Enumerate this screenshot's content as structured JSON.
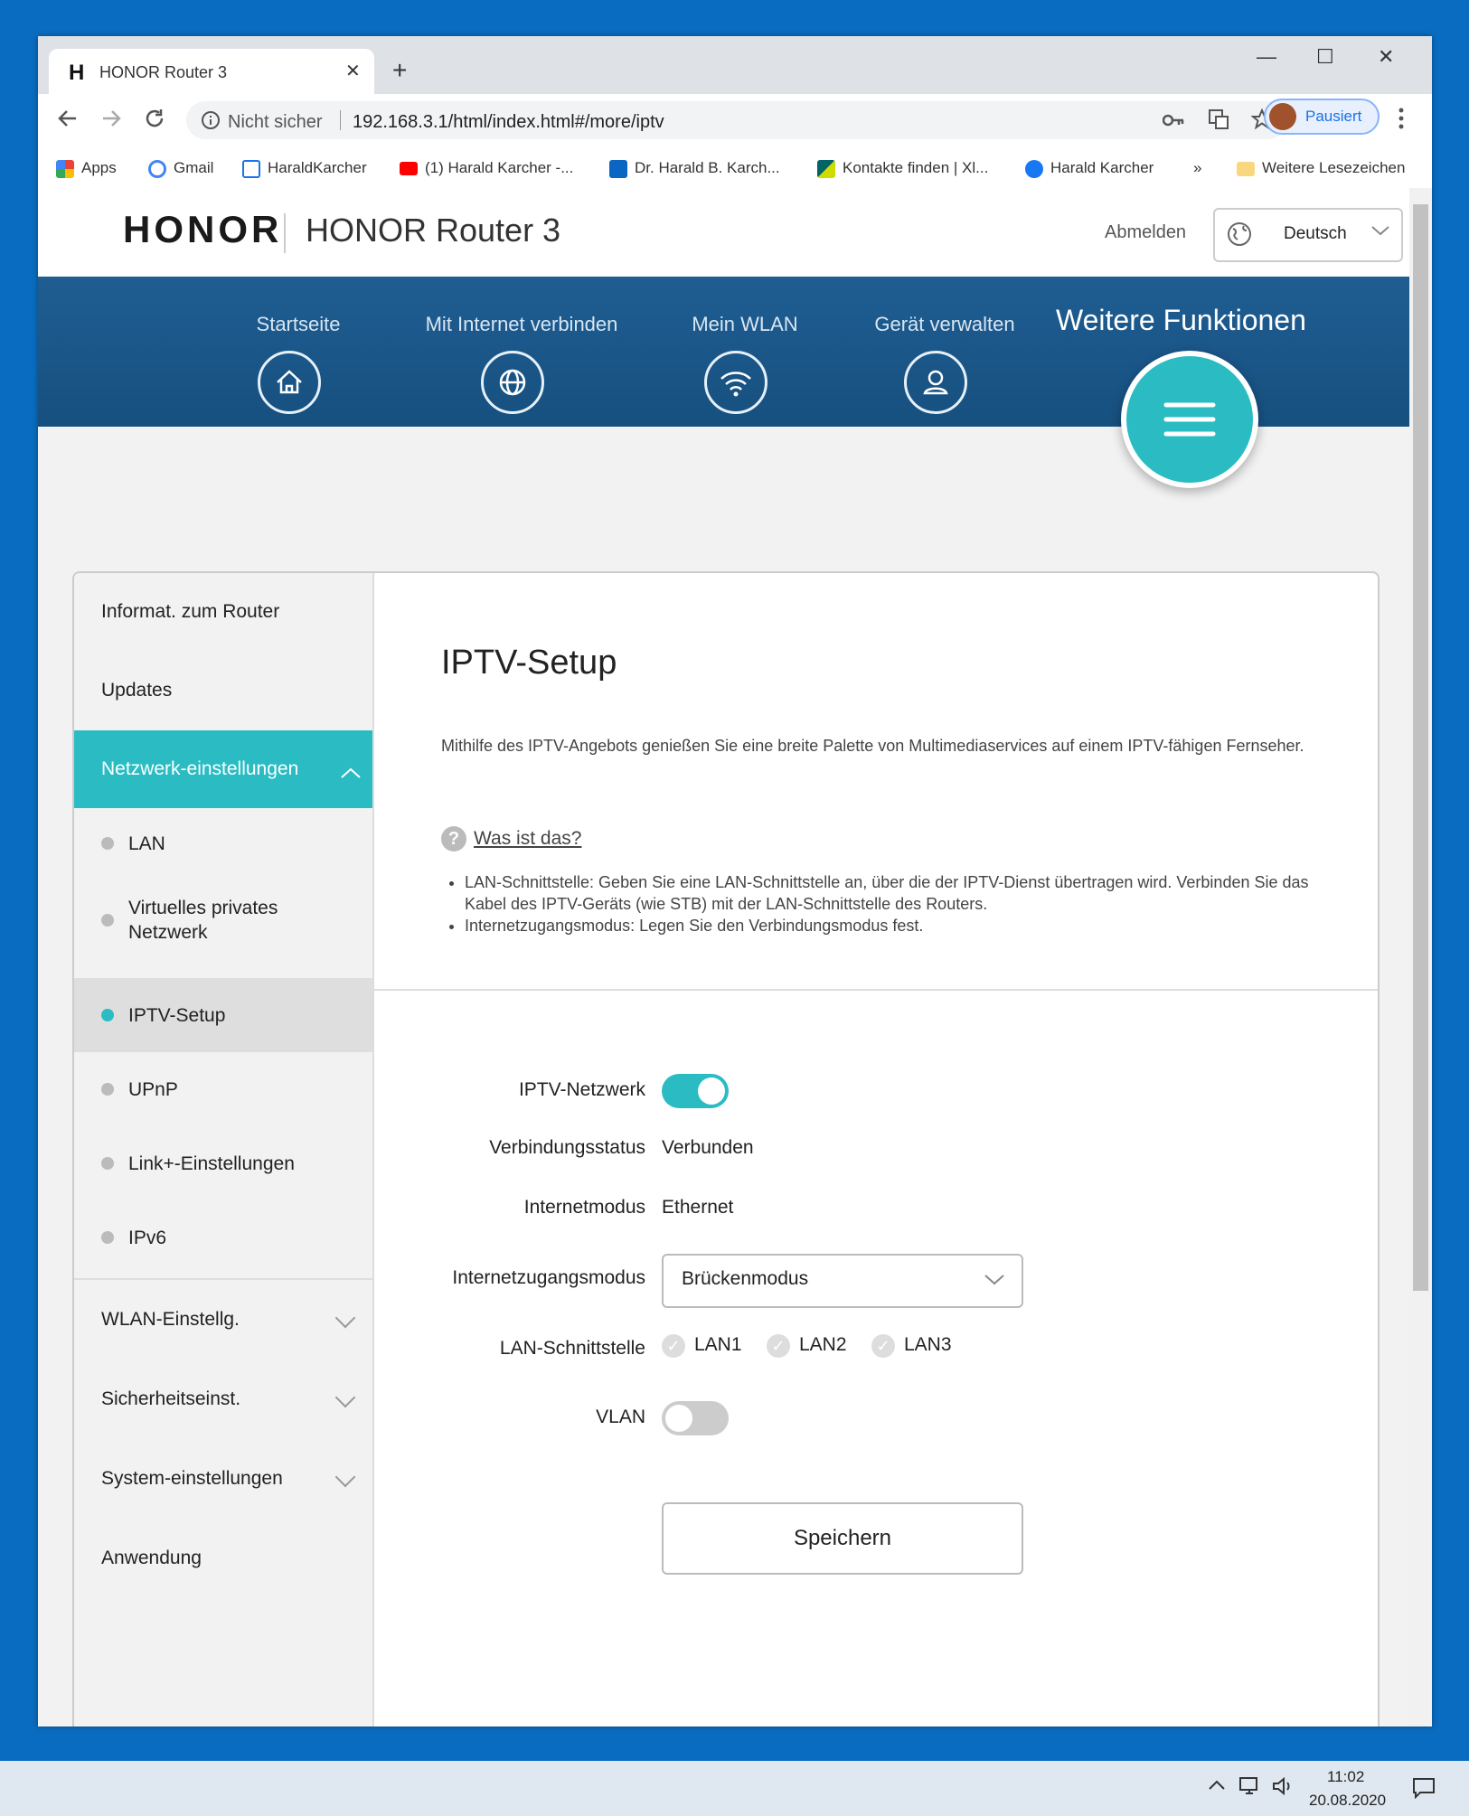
{
  "browser": {
    "tab_logo": "H",
    "tab_title": "HONOR Router 3",
    "close_glyph": "✕",
    "new_tab_glyph": "+",
    "minimize_glyph": "—",
    "maximize_glyph": "☐",
    "window_close_glyph": "✕",
    "security_label": "Nicht sicher",
    "url": "192.168.3.1/html/index.html#/more/iptv",
    "profile_label": "Pausiert",
    "bookmarks": [
      "Apps",
      "Gmail",
      "HaraldKarcher",
      "(1) Harald Karcher -...",
      "Dr. Harald B. Karch...",
      "Kontakte finden | Xl...",
      "Harald Karcher"
    ],
    "bookmarks_more": "»",
    "other_bookmarks": "Weitere Lesezeichen"
  },
  "header": {
    "brand": "HONOR",
    "router_name": "HONOR Router 3",
    "logout": "Abmelden",
    "language": "Deutsch"
  },
  "nav": {
    "items": [
      "Startseite",
      "Mit Internet verbinden",
      "Mein WLAN",
      "Gerät verwalten"
    ],
    "active": "Weitere Funktionen"
  },
  "sidebar": {
    "items": [
      "Informat. zum Router",
      "Updates",
      "Netzwerk-einstellungen"
    ],
    "sub_items": [
      "LAN",
      "Virtuelles privates Netzwerk",
      "IPTV-Setup",
      "UPnP",
      "Link+-Einstellungen",
      "IPv6"
    ],
    "groups": [
      "WLAN-Einstellg.",
      "Sicherheitseinst.",
      "System-einstellungen",
      "Anwendung"
    ]
  },
  "main": {
    "title": "IPTV-Setup",
    "description": "Mithilfe des IPTV-Angebots genießen Sie eine breite Palette von Multimediaservices auf einem IPTV-fähigen Fernseher.",
    "help_glyph": "?",
    "help_link": "Was ist das?",
    "bullet_1": "LAN-Schnittstelle: Geben Sie eine LAN-Schnittstelle an, über die der IPTV-Dienst übertragen wird. Verbinden Sie das Kabel des IPTV-Geräts (wie STB) mit der LAN-Schnittstelle des Routers.",
    "bullet_2": "Internetzugangsmodus: Legen Sie den Verbindungsmodus fest.",
    "fields": {
      "iptv_label": "IPTV-Netzwerk",
      "iptv_on": true,
      "status_label": "Verbindungsstatus",
      "status_value": "Verbunden",
      "mode_label": "Internetmodus",
      "mode_value": "Ethernet",
      "access_label": "Internetzugangsmodus",
      "access_value": "Brückenmodus",
      "lan_label": "LAN-Schnittstelle",
      "lan_options": [
        "LAN1",
        "LAN2",
        "LAN3"
      ],
      "check_glyph": "✓",
      "vlan_label": "VLAN",
      "vlan_on": false
    },
    "save": "Speichern"
  },
  "taskbar": {
    "time": "11:02",
    "date": "20.08.2020"
  },
  "colors": {
    "accent": "#2abcc2",
    "nav_bg": "#1f5d92",
    "desktop": "#0a6cc0"
  }
}
